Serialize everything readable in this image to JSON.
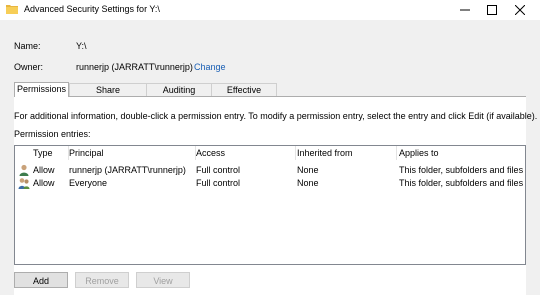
{
  "window": {
    "title": "Advanced Security Settings for Y:\\"
  },
  "info": {
    "name_label": "Name:",
    "name_value": "Y:\\",
    "owner_label": "Owner:",
    "owner_value": "runnerjp (JARRATT\\runnerjp)",
    "change_link": "Change"
  },
  "tabs": [
    {
      "label": "Permissions",
      "active": true
    },
    {
      "label": "Share",
      "active": false
    },
    {
      "label": "Auditing",
      "active": false
    },
    {
      "label": "Effective Access",
      "active": false
    }
  ],
  "permissions": {
    "info_text": "For additional information, double-click a permission entry. To modify a permission entry, select the entry and click Edit (if available).",
    "entries_label": "Permission entries:",
    "columns": [
      "Type",
      "Principal",
      "Access",
      "Inherited from",
      "Applies to"
    ],
    "rows": [
      {
        "icon": "user-icon",
        "type": "Allow",
        "principal": "runnerjp (JARRATT\\runnerjp)",
        "access": "Full control",
        "inherited": "None",
        "applies": "This folder, subfolders and files"
      },
      {
        "icon": "group-icon",
        "type": "Allow",
        "principal": "Everyone",
        "access": "Full control",
        "inherited": "None",
        "applies": "This folder, subfolders and files"
      }
    ]
  },
  "buttons": {
    "add": "Add",
    "remove": "Remove",
    "view": "View"
  }
}
